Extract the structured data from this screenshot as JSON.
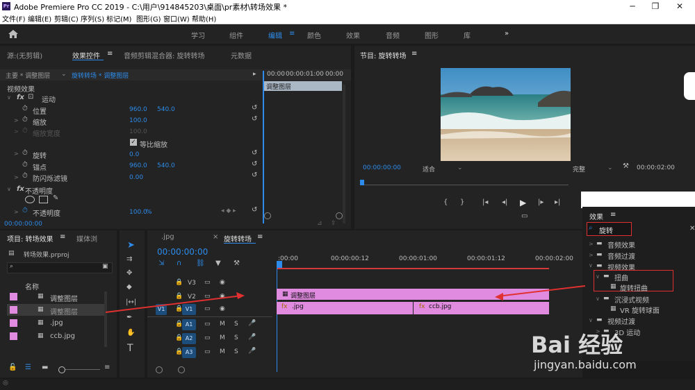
{
  "titlebar": {
    "app_icon": "Pr",
    "title": "Adobe Premiere Pro CC 2019 - C:\\用户\\914845203\\桌面\\pr素材\\转场效果 *",
    "minimize": "─",
    "maximize": "❐",
    "close": "✕"
  },
  "menu": [
    "文件(F)",
    "编辑(E)",
    "剪辑(C)",
    "序列(S)",
    "标记(M)",
    "图形(G)",
    "窗口(W)",
    "帮助(H)"
  ],
  "workspaces": [
    "学习",
    "组件",
    "编辑",
    "颜色",
    "效果",
    "音频",
    "图形",
    "库"
  ],
  "workspace_active": "编辑",
  "workspace_more": "»",
  "effect_controls": {
    "tabs": [
      "源:(无剪辑)",
      "效果控件",
      "音频剪辑混合器: 旋转转场",
      "元数据"
    ],
    "tab_menu": "≡",
    "master_label": "主要 * 调整图层",
    "clip_label": "旋转转场 * 调整图层",
    "ruler": [
      "00:00",
      "00:00:01:00",
      "00:00"
    ],
    "clip_bar": "调整图层",
    "video_effects": "视频效果",
    "motion": "运动",
    "position": {
      "label": "位置",
      "x": "960.0",
      "y": "540.0"
    },
    "scale": {
      "label": "缩放",
      "value": "100.0"
    },
    "scale_width": {
      "label": "缩放宽度",
      "value": "100.0"
    },
    "uniform_scale": "等比缩放",
    "rotation": {
      "label": "旋转",
      "value": "0.0"
    },
    "anchor": {
      "label": "锚点",
      "x": "960.0",
      "y": "540.0"
    },
    "anti_flicker": {
      "label": "防闪烁滤镜",
      "value": "0.00"
    },
    "opacity_group": "不透明度",
    "opacity": {
      "label": "不透明度",
      "value": "100.0",
      "unit": "%"
    },
    "timecode": "00:00:00:00"
  },
  "program_monitor": {
    "title": "节目: 旋转转场",
    "timecode": "00:00:00:00",
    "fit": "适合",
    "quality": "完整",
    "duration": "00:00:02:00"
  },
  "project": {
    "title": "项目: 转场效果",
    "tab_media": "媒体浏",
    "file": "转场效果.prproj",
    "column_name": "名称",
    "items": [
      {
        "name": "调整图层",
        "color": "#e08ae0"
      },
      {
        "name": "调整图层",
        "color": "#e08ae0"
      },
      {
        "name": ".jpg",
        "color": "#e08ae0"
      },
      {
        "name": "ccb.jpg",
        "color": "#e08ae0"
      }
    ]
  },
  "timeline": {
    "tab_prev": ".jpg",
    "tab_close": "×",
    "title": "旋转转场",
    "timecode": "00:00:00:00",
    "ruler": [
      ":00:00",
      "00:00:00:12",
      "00:00:01:00",
      "00:00:01:12",
      "00:00:02:00"
    ],
    "video_tracks": [
      "V3",
      "V2",
      "V1"
    ],
    "audio_tracks": [
      "A1",
      "A2",
      "A3"
    ],
    "src_v": "V1",
    "audio_m": "M",
    "audio_s": "S",
    "clip_v2": "调整图层",
    "clip_v1a": ".jpg",
    "clip_v1b": "ccb.jpg"
  },
  "effects_panel": {
    "title": "效果",
    "search_value": "旋转",
    "items": [
      {
        "label": "音频效果",
        "indent": 0
      },
      {
        "label": "音频过渡",
        "indent": 0
      },
      {
        "label": "视频效果",
        "indent": 0
      },
      {
        "label": "扭曲",
        "indent": 1
      },
      {
        "label": "旋转扭曲",
        "indent": 2
      },
      {
        "label": "沉浸式视频",
        "indent": 1
      },
      {
        "label": "VR 旋转球面",
        "indent": 2
      },
      {
        "label": "视频过渡",
        "indent": 0
      },
      {
        "label": "3D 运动",
        "indent": 1
      }
    ]
  },
  "watermark": {
    "brand": "Bai 经验",
    "url": "jingyan.baidu.com"
  },
  "colors": {
    "accent": "#2d8ceb",
    "clip": "#e08ae0",
    "highlight": "#e03030"
  }
}
